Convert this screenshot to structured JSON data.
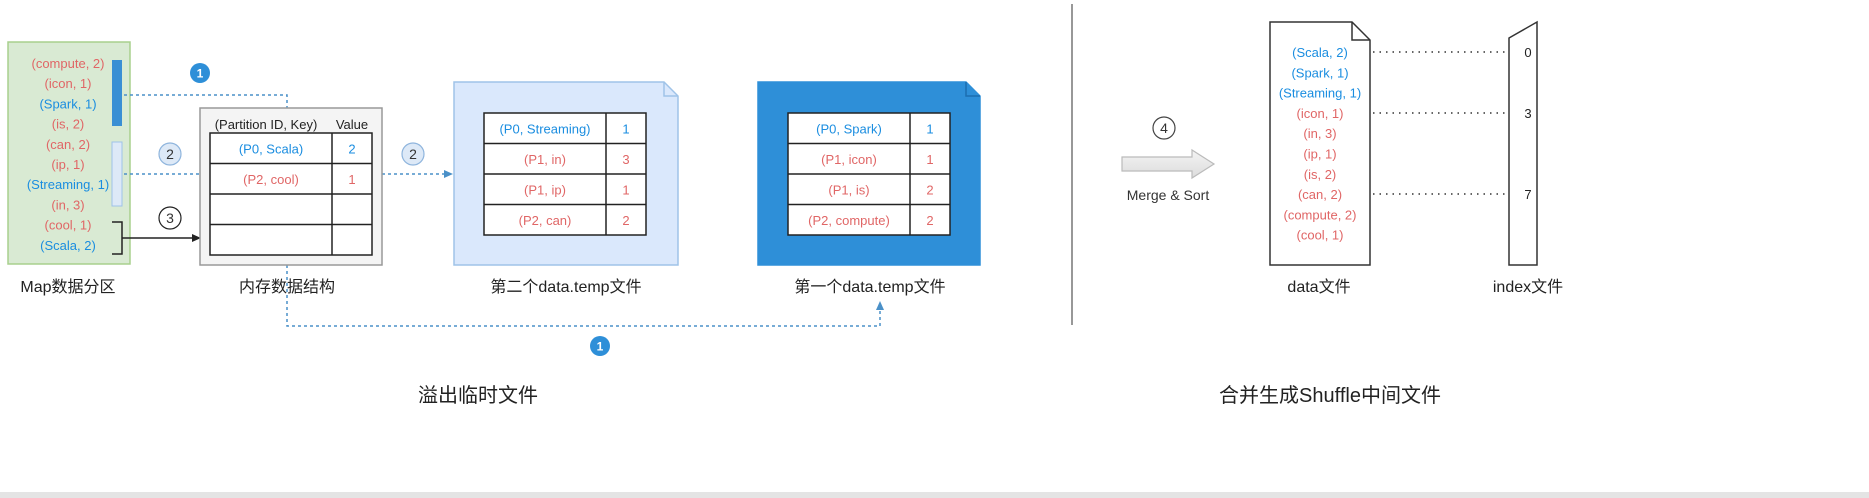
{
  "colors": {
    "red": "#e06666",
    "blue": "#1a8de0",
    "dark": "#333333"
  },
  "map_partition": {
    "label": "Map数据分区",
    "items": [
      {
        "text": "(compute, 2)",
        "color": "red"
      },
      {
        "text": "(icon, 1)",
        "color": "red"
      },
      {
        "text": "(Spark, 1)",
        "color": "blue"
      },
      {
        "text": "(is, 2)",
        "color": "red"
      },
      {
        "text": "(can, 2)",
        "color": "red"
      },
      {
        "text": "(ip, 1)",
        "color": "red"
      },
      {
        "text": "(Streaming, 1)",
        "color": "blue"
      },
      {
        "text": "(in, 3)",
        "color": "red"
      },
      {
        "text": "(cool, 1)",
        "color": "red"
      },
      {
        "text": "(Scala, 2)",
        "color": "blue"
      }
    ]
  },
  "memory": {
    "label": "内存数据结构",
    "header_key": "(Partition ID, Key)",
    "header_value": "Value",
    "rows": [
      {
        "key": "(P0, Scala)",
        "value": "2",
        "color": "blue"
      },
      {
        "key": "(P2, cool)",
        "value": "1",
        "color": "red"
      },
      {
        "key": "",
        "value": "",
        "color": "dark"
      },
      {
        "key": "",
        "value": "",
        "color": "dark"
      }
    ]
  },
  "temp2": {
    "label": "第二个data.temp文件",
    "rows": [
      {
        "key": "(P0, Streaming)",
        "value": "1",
        "color": "blue"
      },
      {
        "key": "(P1, in)",
        "value": "3",
        "color": "red"
      },
      {
        "key": "(P1, ip)",
        "value": "1",
        "color": "red"
      },
      {
        "key": "(P2, can)",
        "value": "2",
        "color": "red"
      }
    ]
  },
  "temp1": {
    "label": "第一个data.temp文件",
    "rows": [
      {
        "key": "(P0, Spark)",
        "value": "1",
        "color": "blue"
      },
      {
        "key": "(P1, icon)",
        "value": "1",
        "color": "red"
      },
      {
        "key": "(P1, is)",
        "value": "2",
        "color": "red"
      },
      {
        "key": "(P2, compute)",
        "value": "2",
        "color": "red"
      }
    ]
  },
  "badges": {
    "one": "1",
    "two": "2",
    "three": "3",
    "four": "4"
  },
  "merge_label": "Merge & Sort",
  "data_file": {
    "label": "data文件",
    "items": [
      {
        "text": "(Scala, 2)",
        "color": "blue"
      },
      {
        "text": "(Spark, 1)",
        "color": "blue"
      },
      {
        "text": "(Streaming, 1)",
        "color": "blue"
      },
      {
        "text": "(icon, 1)",
        "color": "red"
      },
      {
        "text": "(in, 3)",
        "color": "red"
      },
      {
        "text": "(ip, 1)",
        "color": "red"
      },
      {
        "text": "(is, 2)",
        "color": "red"
      },
      {
        "text": "(can, 2)",
        "color": "red"
      },
      {
        "text": "(compute, 2)",
        "color": "red"
      },
      {
        "text": "(cool, 1)",
        "color": "red"
      }
    ]
  },
  "index_file": {
    "label": "index文件",
    "values": [
      "0",
      "3",
      "7"
    ]
  },
  "captions": {
    "left": "溢出临时文件",
    "right": "合并生成Shuffle中间文件"
  }
}
